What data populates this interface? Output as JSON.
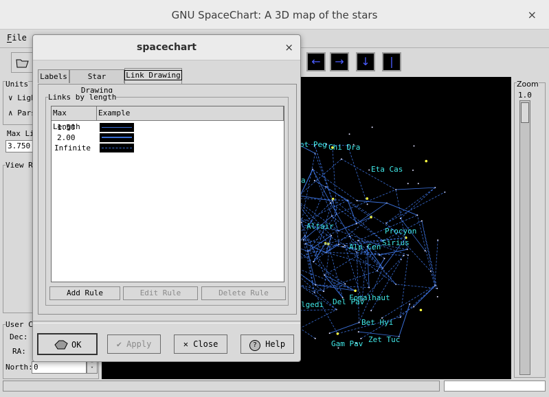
{
  "window": {
    "title": "GNU SpaceChart: A 3D map of the stars",
    "close_glyph": "×"
  },
  "menu": {
    "file": "File"
  },
  "left_panel": {
    "units_label": "Units",
    "units_light": "Ligh",
    "units_parsecs": "Pars",
    "max_link_label": "Max Li",
    "max_link_value": "3.750",
    "view_label": "View R",
    "user_coords_label": "User C",
    "dec_label": "Dec:",
    "ra_label": "RA:",
    "north_label": "North:",
    "north_value": "0"
  },
  "zoom": {
    "label": "Zoom",
    "value": "1.0"
  },
  "star_labels": [
    "pt Peg",
    "Chi Dra",
    "Eta Cas",
    "a",
    "Altair",
    "Procyon",
    "Sirius",
    "Alp Cen",
    "lgedi",
    "Fomalhaut",
    "Del Pav",
    "Bet Hyi",
    "Gam Pav",
    "Zet Tuc"
  ],
  "dialog": {
    "title": "spacechart",
    "close_glyph": "×",
    "tabs": [
      "Labels",
      "Star Drawing",
      "Link Drawing"
    ],
    "active_tab": "Link Drawing",
    "group_label": "Links by length",
    "columns": [
      "Max Length",
      "Example"
    ],
    "rules": [
      {
        "max_length": "1.50",
        "style": "solid-thin"
      },
      {
        "max_length": "2.00",
        "style": "solid-thick"
      },
      {
        "max_length": "Infinite",
        "style": "dashed"
      }
    ],
    "buttons": {
      "add_rule": "Add Rule",
      "edit_rule": "Edit Rule",
      "delete_rule": "Delete Rule"
    },
    "footer": {
      "ok": "OK",
      "apply": "Apply",
      "close": "Close",
      "help": "Help"
    }
  },
  "colors": {
    "link_line": "#3a6fd8",
    "star_label": "#40e8e8",
    "canvas_bg": "#000000",
    "star_yellow": "#ffff40"
  }
}
